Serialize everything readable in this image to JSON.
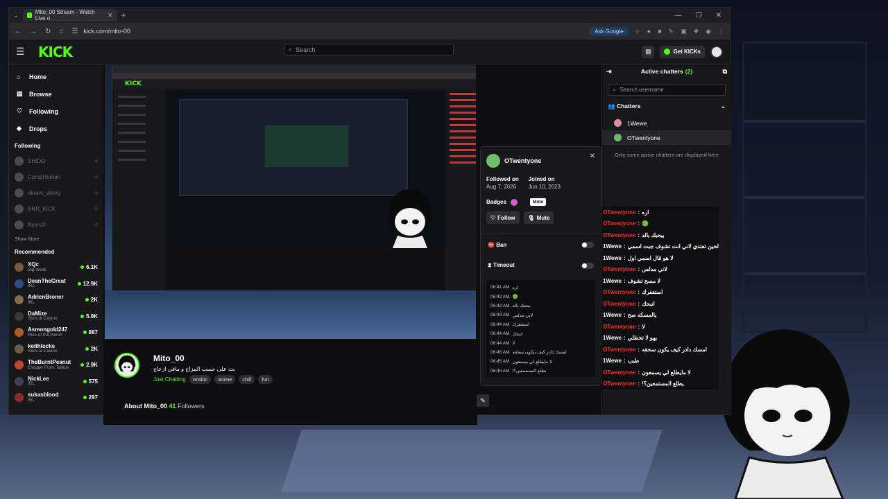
{
  "browser": {
    "tab_title": "Mito_00 Stream - Watch Live o",
    "url": "kick.com/mito-00",
    "ask_google": "Ask Google"
  },
  "header": {
    "logo": "KICK",
    "search_placeholder": "Search",
    "get_kicks": "Get KICKs"
  },
  "sidebar": {
    "nav": [
      {
        "label": "Home",
        "icon": "home-icon"
      },
      {
        "label": "Browse",
        "icon": "browse-icon"
      },
      {
        "label": "Following",
        "icon": "heart-icon"
      },
      {
        "label": "Drops",
        "icon": "drops-icon"
      }
    ],
    "following_title": "Following",
    "following": [
      "SHIDO",
      "CompHuman",
      "akram_viking",
      "BNR_KICK",
      "NyvroX"
    ],
    "show_more": "Show More",
    "recommended_title": "Recommended",
    "recommended": [
      {
        "name": "XQc",
        "category": "Big Wwik",
        "viewers": "6.1K"
      },
      {
        "name": "DeanTheGreat",
        "category": "IRL",
        "viewers": "12.9K"
      },
      {
        "name": "AdrienBroner",
        "category": "IRL",
        "viewers": "2K"
      },
      {
        "name": "DaMize",
        "category": "Slots & Casino",
        "viewers": "5.9K"
      },
      {
        "name": "Asmongold247",
        "category": "Rise of the Ronin",
        "viewers": "887"
      },
      {
        "name": "keithlocks",
        "category": "Slots & Casino",
        "viewers": "2K"
      },
      {
        "name": "TheBurntPeanut",
        "category": "Escape From Tarkov",
        "viewers": "2.9K"
      },
      {
        "name": "NickLee",
        "category": "IRL",
        "viewers": "575"
      },
      {
        "name": "sukasblood",
        "category": "IRL",
        "viewers": "297"
      }
    ]
  },
  "stream": {
    "channel": "Mito_00",
    "title": "بث على حسب المزاج و مافي ازعاج",
    "category": "Just Chatting",
    "tags": [
      "Arabic",
      "anime",
      "chill",
      "fun"
    ],
    "about_label": "About Mito_00",
    "followers_count": "41",
    "followers_label": "Followers"
  },
  "usercard": {
    "username": "OTwentyone",
    "followed_on_label": "Followed on",
    "followed_on": "Aug 7, 2026",
    "joined_on_label": "Joined on",
    "joined_on": "Jun 10, 2023",
    "badges_label": "Badges",
    "mute_tooltip": "Mute",
    "follow_label": "Follow",
    "mute_label": "Mute",
    "ban_label": "Ban",
    "timeout_label": "Timeout",
    "history": [
      {
        "time": "06:41 AM",
        "msg": "اره"
      },
      {
        "time": "06:42 AM",
        "msg": "🟢"
      },
      {
        "time": "06:42 AM",
        "msg": "بيحبك بالد"
      },
      {
        "time": "06:43 AM",
        "msg": "لاني مدلس"
      },
      {
        "time": "06:44 AM",
        "msg": "استغفرك"
      },
      {
        "time": "06:44 AM",
        "msg": "انبحك"
      },
      {
        "time": "06:44 AM",
        "msg": "لا"
      },
      {
        "time": "06:45 AM",
        "msg": "امسك دادر كيف بيكون سحقه"
      },
      {
        "time": "06:45 AM",
        "msg": "لا مايطلع لي يسمعون"
      },
      {
        "time": "06:45 AM",
        "msg": "بطلع المستمعين؟!"
      }
    ]
  },
  "chatters": {
    "title": "Active chatters",
    "count": "(2)",
    "search_placeholder": "Search username",
    "section": "Chatters",
    "list": [
      {
        "name": "1Wewe",
        "color": "#e48ca8"
      },
      {
        "name": "OTwentyone",
        "color": "#6dbf6a"
      }
    ],
    "note": "Only some active chatters are displayed here"
  },
  "chat": [
    {
      "user": "OTwentyone",
      "msg": "اره"
    },
    {
      "user": "OTwentyone",
      "msg": "🟢"
    },
    {
      "user": "OTwentyone",
      "msg": "بيحبك بالد"
    },
    {
      "user": "1Wewe",
      "msg": "الحين تعتدي لاني انت تشوف جبت اسمي"
    },
    {
      "user": "1Wewe",
      "msg": "لا هو قال اسمي اول"
    },
    {
      "user": "OTwentyone",
      "msg": "لاني مدلس"
    },
    {
      "user": "1Wewe",
      "msg": "لا مسح تشوف"
    },
    {
      "user": "OTwentyone",
      "msg": "استغفرك"
    },
    {
      "user": "OTwentyone",
      "msg": "انبحك"
    },
    {
      "user": "1Wewe",
      "msg": "يالمسكه صح"
    },
    {
      "user": "OTwentyone",
      "msg": "لا"
    },
    {
      "user": "1Wewe",
      "msg": "يهو لا تخطلي"
    },
    {
      "user": "OTwentyone",
      "msg": "امسك دادر كيف يكون سحقه"
    },
    {
      "user": "1Wewe",
      "msg": "طيب"
    },
    {
      "user": "OTwentyone",
      "msg": "لا مايطلع لي يسمعون"
    },
    {
      "user": "OTwentyone",
      "msg": "يطلع المستمعين؟!"
    }
  ],
  "colors": {
    "brand": "#53fc18",
    "chat_red": "#ff2a2a"
  }
}
